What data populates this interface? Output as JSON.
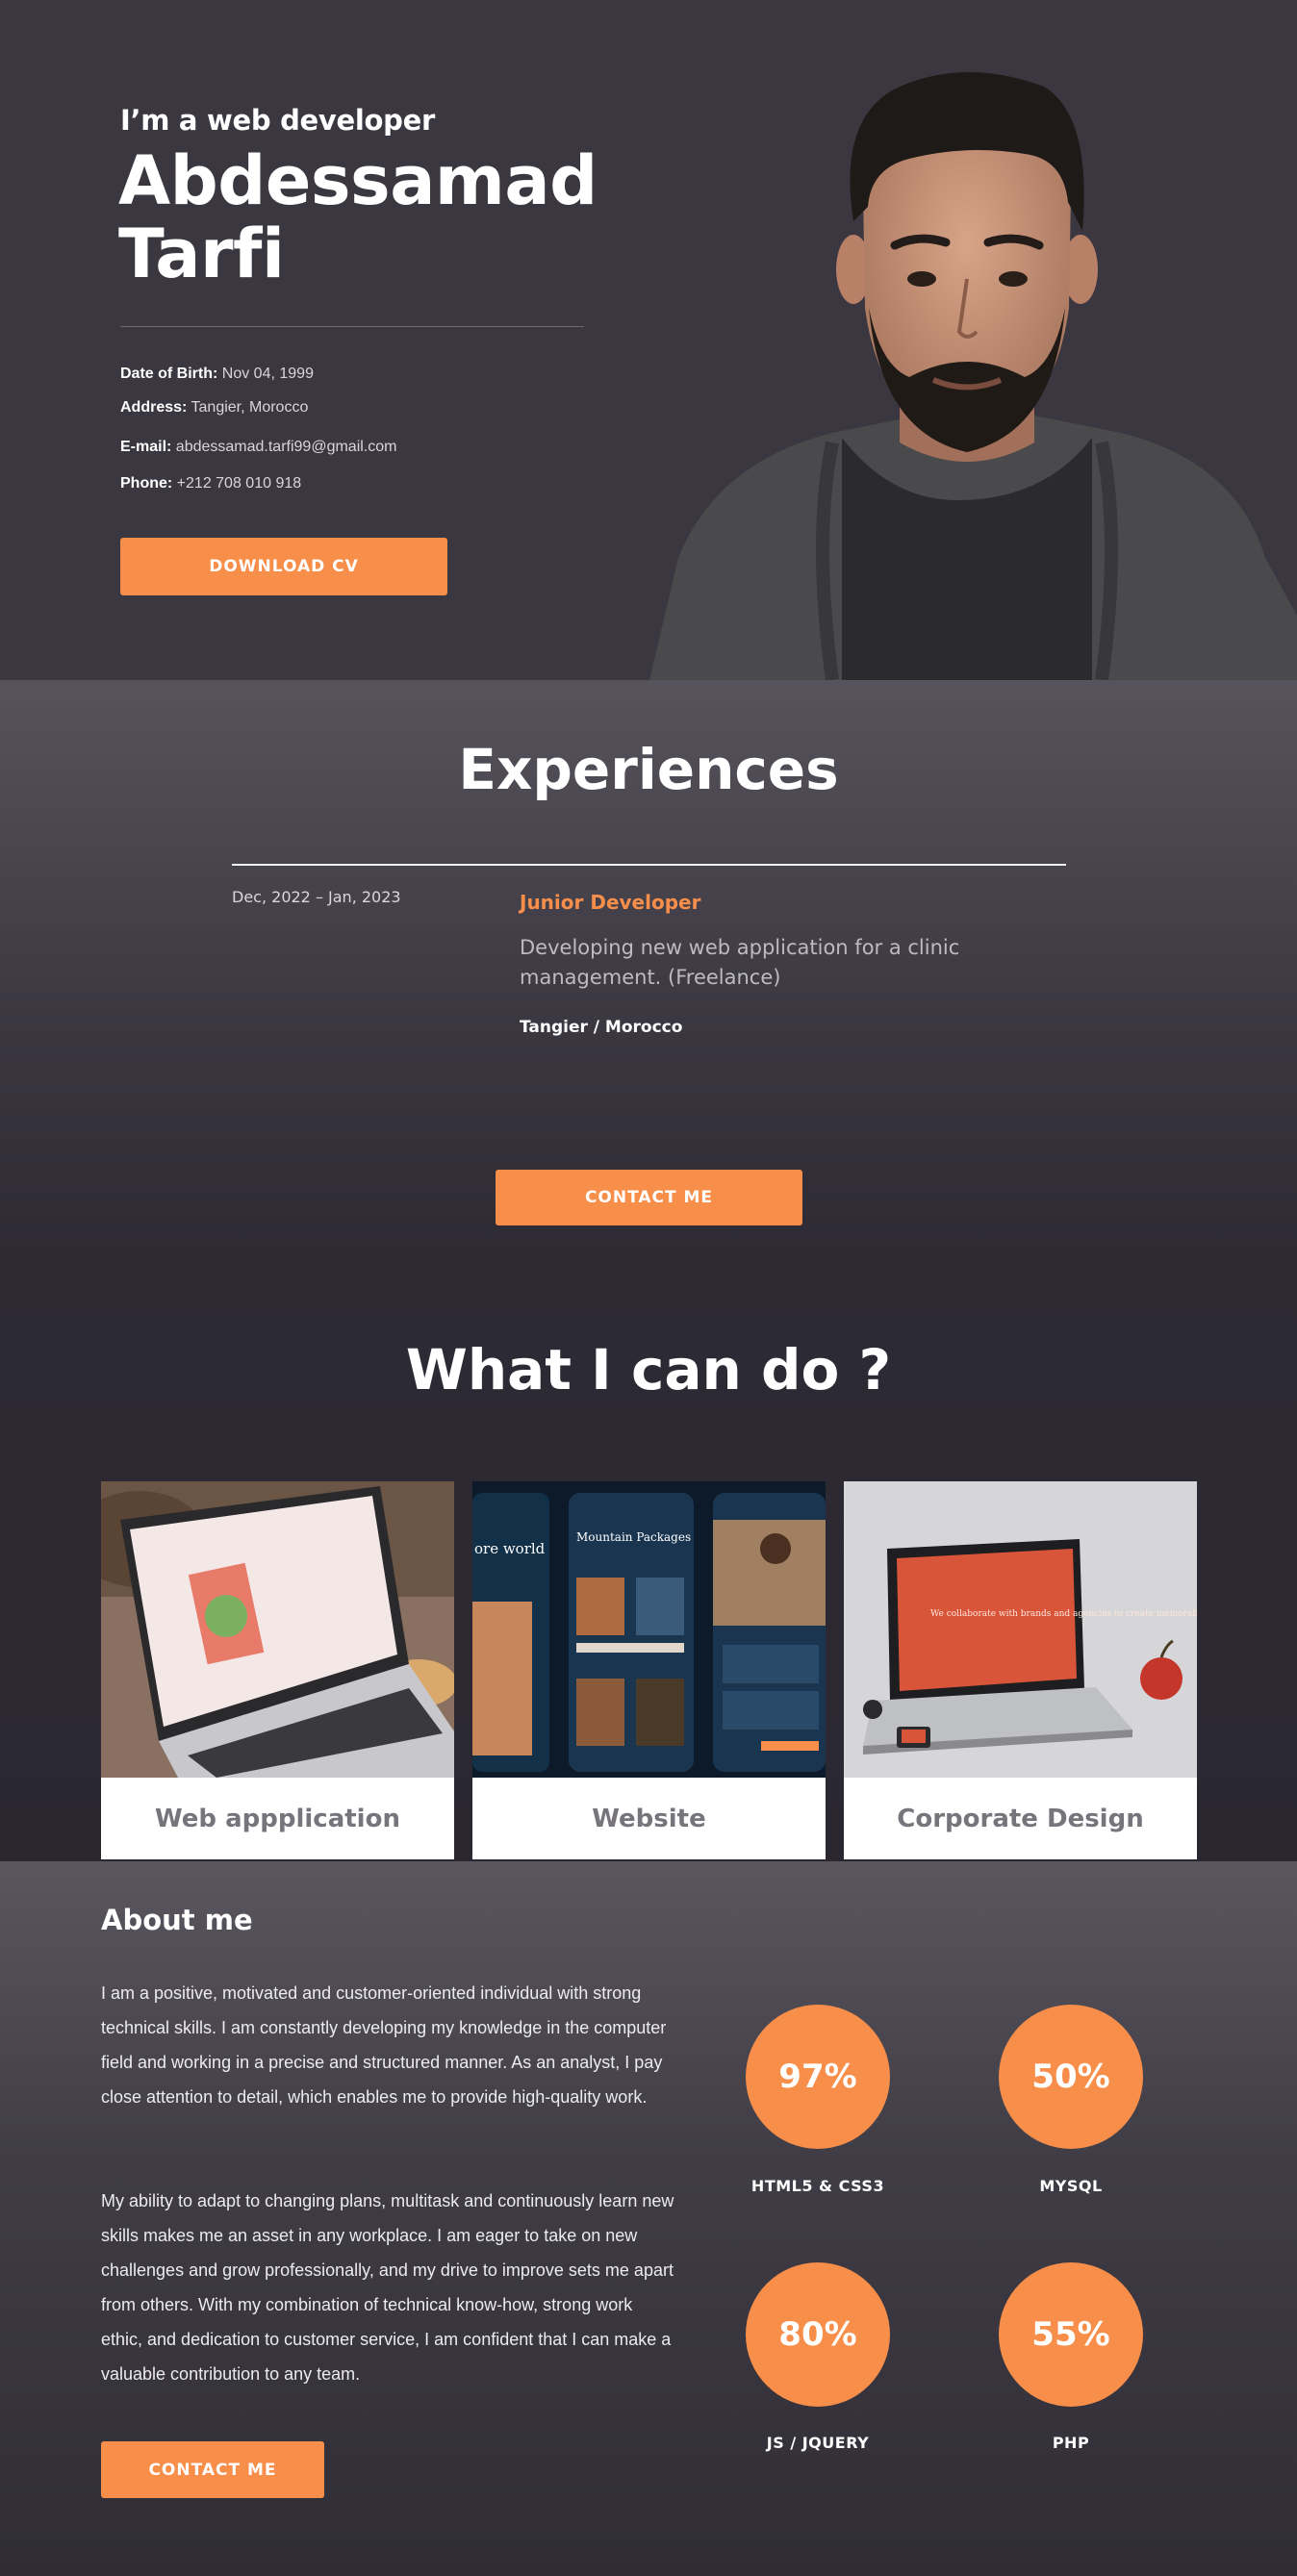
{
  "hero": {
    "subtitle": "I’m a web developer",
    "name": "Abdessamad Tarfi",
    "info": [
      {
        "label": "Date of Birth:",
        "value": "Nov 04, 1999"
      },
      {
        "label": "Address:",
        "value": "Tangier, Morocco"
      },
      {
        "label": "E-mail:",
        "value": "abdessamad.tarfi99@gmail.com"
      },
      {
        "label": "Phone:",
        "value": "+212 708 010 918"
      }
    ],
    "download_label": "DOWNLOAD CV"
  },
  "experiences": {
    "title": "Experiences",
    "items": [
      {
        "date": "Dec, 2022 – Jan, 2023",
        "role": "Junior Developer",
        "description": "Developing new web application for a clinic management. (Freelance)",
        "location": "Tangier / Morocco"
      }
    ],
    "contact_label": "CONTACT ME"
  },
  "services": {
    "title": "What I can do ?",
    "cards": [
      {
        "label": "Web appplication"
      },
      {
        "label": "Website"
      },
      {
        "label": "Corporate Design"
      }
    ],
    "mockup_texts": {
      "mountain": "Mountain Packages",
      "explore": "ore world",
      "collab": "We collaborate with brands and agencies to create memorable experiences"
    }
  },
  "about": {
    "title": "About me",
    "paragraphs": [
      "I am a positive, motivated and customer-oriented individual with strong technical skills. I am constantly developing my knowledge in the computer field and working in a precise and structured manner. As an analyst, I pay close attention to detail, which enables me to provide high-quality work.",
      "My ability to adapt to changing plans, multitask and continuously learn new skills makes me an asset in any workplace. I am eager to take on new challenges and grow professionally, and my drive to improve sets me apart from others. With my combination of technical know-how, strong work ethic, and dedication to customer service, I am confident that I can make a valuable contribution to any team."
    ],
    "contact_label": "CONTACT ME",
    "skills": [
      {
        "percent": "97%",
        "name": "HTML5 & CSS3"
      },
      {
        "percent": "50%",
        "name": "MYSQL"
      },
      {
        "percent": "80%",
        "name": "JS / JQUERY"
      },
      {
        "percent": "55%",
        "name": "PHP"
      }
    ]
  },
  "colors": {
    "accent": "#f78e4a",
    "hero_bg": "#3a3740",
    "card_label": "#77747b"
  }
}
